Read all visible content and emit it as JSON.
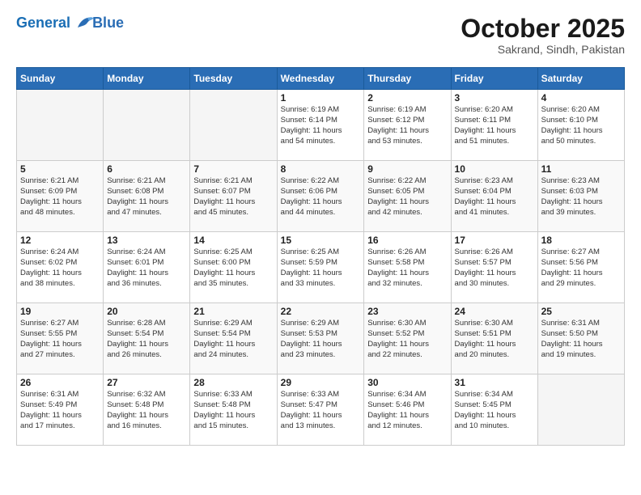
{
  "header": {
    "logo_line1": "General",
    "logo_line2": "Blue",
    "month": "October 2025",
    "location": "Sakrand, Sindh, Pakistan"
  },
  "weekdays": [
    "Sunday",
    "Monday",
    "Tuesday",
    "Wednesday",
    "Thursday",
    "Friday",
    "Saturday"
  ],
  "weeks": [
    [
      {
        "day": "",
        "text": ""
      },
      {
        "day": "",
        "text": ""
      },
      {
        "day": "",
        "text": ""
      },
      {
        "day": "1",
        "text": "Sunrise: 6:19 AM\nSunset: 6:14 PM\nDaylight: 11 hours\nand 54 minutes."
      },
      {
        "day": "2",
        "text": "Sunrise: 6:19 AM\nSunset: 6:12 PM\nDaylight: 11 hours\nand 53 minutes."
      },
      {
        "day": "3",
        "text": "Sunrise: 6:20 AM\nSunset: 6:11 PM\nDaylight: 11 hours\nand 51 minutes."
      },
      {
        "day": "4",
        "text": "Sunrise: 6:20 AM\nSunset: 6:10 PM\nDaylight: 11 hours\nand 50 minutes."
      }
    ],
    [
      {
        "day": "5",
        "text": "Sunrise: 6:21 AM\nSunset: 6:09 PM\nDaylight: 11 hours\nand 48 minutes."
      },
      {
        "day": "6",
        "text": "Sunrise: 6:21 AM\nSunset: 6:08 PM\nDaylight: 11 hours\nand 47 minutes."
      },
      {
        "day": "7",
        "text": "Sunrise: 6:21 AM\nSunset: 6:07 PM\nDaylight: 11 hours\nand 45 minutes."
      },
      {
        "day": "8",
        "text": "Sunrise: 6:22 AM\nSunset: 6:06 PM\nDaylight: 11 hours\nand 44 minutes."
      },
      {
        "day": "9",
        "text": "Sunrise: 6:22 AM\nSunset: 6:05 PM\nDaylight: 11 hours\nand 42 minutes."
      },
      {
        "day": "10",
        "text": "Sunrise: 6:23 AM\nSunset: 6:04 PM\nDaylight: 11 hours\nand 41 minutes."
      },
      {
        "day": "11",
        "text": "Sunrise: 6:23 AM\nSunset: 6:03 PM\nDaylight: 11 hours\nand 39 minutes."
      }
    ],
    [
      {
        "day": "12",
        "text": "Sunrise: 6:24 AM\nSunset: 6:02 PM\nDaylight: 11 hours\nand 38 minutes."
      },
      {
        "day": "13",
        "text": "Sunrise: 6:24 AM\nSunset: 6:01 PM\nDaylight: 11 hours\nand 36 minutes."
      },
      {
        "day": "14",
        "text": "Sunrise: 6:25 AM\nSunset: 6:00 PM\nDaylight: 11 hours\nand 35 minutes."
      },
      {
        "day": "15",
        "text": "Sunrise: 6:25 AM\nSunset: 5:59 PM\nDaylight: 11 hours\nand 33 minutes."
      },
      {
        "day": "16",
        "text": "Sunrise: 6:26 AM\nSunset: 5:58 PM\nDaylight: 11 hours\nand 32 minutes."
      },
      {
        "day": "17",
        "text": "Sunrise: 6:26 AM\nSunset: 5:57 PM\nDaylight: 11 hours\nand 30 minutes."
      },
      {
        "day": "18",
        "text": "Sunrise: 6:27 AM\nSunset: 5:56 PM\nDaylight: 11 hours\nand 29 minutes."
      }
    ],
    [
      {
        "day": "19",
        "text": "Sunrise: 6:27 AM\nSunset: 5:55 PM\nDaylight: 11 hours\nand 27 minutes."
      },
      {
        "day": "20",
        "text": "Sunrise: 6:28 AM\nSunset: 5:54 PM\nDaylight: 11 hours\nand 26 minutes."
      },
      {
        "day": "21",
        "text": "Sunrise: 6:29 AM\nSunset: 5:54 PM\nDaylight: 11 hours\nand 24 minutes."
      },
      {
        "day": "22",
        "text": "Sunrise: 6:29 AM\nSunset: 5:53 PM\nDaylight: 11 hours\nand 23 minutes."
      },
      {
        "day": "23",
        "text": "Sunrise: 6:30 AM\nSunset: 5:52 PM\nDaylight: 11 hours\nand 22 minutes."
      },
      {
        "day": "24",
        "text": "Sunrise: 6:30 AM\nSunset: 5:51 PM\nDaylight: 11 hours\nand 20 minutes."
      },
      {
        "day": "25",
        "text": "Sunrise: 6:31 AM\nSunset: 5:50 PM\nDaylight: 11 hours\nand 19 minutes."
      }
    ],
    [
      {
        "day": "26",
        "text": "Sunrise: 6:31 AM\nSunset: 5:49 PM\nDaylight: 11 hours\nand 17 minutes."
      },
      {
        "day": "27",
        "text": "Sunrise: 6:32 AM\nSunset: 5:48 PM\nDaylight: 11 hours\nand 16 minutes."
      },
      {
        "day": "28",
        "text": "Sunrise: 6:33 AM\nSunset: 5:48 PM\nDaylight: 11 hours\nand 15 minutes."
      },
      {
        "day": "29",
        "text": "Sunrise: 6:33 AM\nSunset: 5:47 PM\nDaylight: 11 hours\nand 13 minutes."
      },
      {
        "day": "30",
        "text": "Sunrise: 6:34 AM\nSunset: 5:46 PM\nDaylight: 11 hours\nand 12 minutes."
      },
      {
        "day": "31",
        "text": "Sunrise: 6:34 AM\nSunset: 5:45 PM\nDaylight: 11 hours\nand 10 minutes."
      },
      {
        "day": "",
        "text": ""
      }
    ]
  ]
}
